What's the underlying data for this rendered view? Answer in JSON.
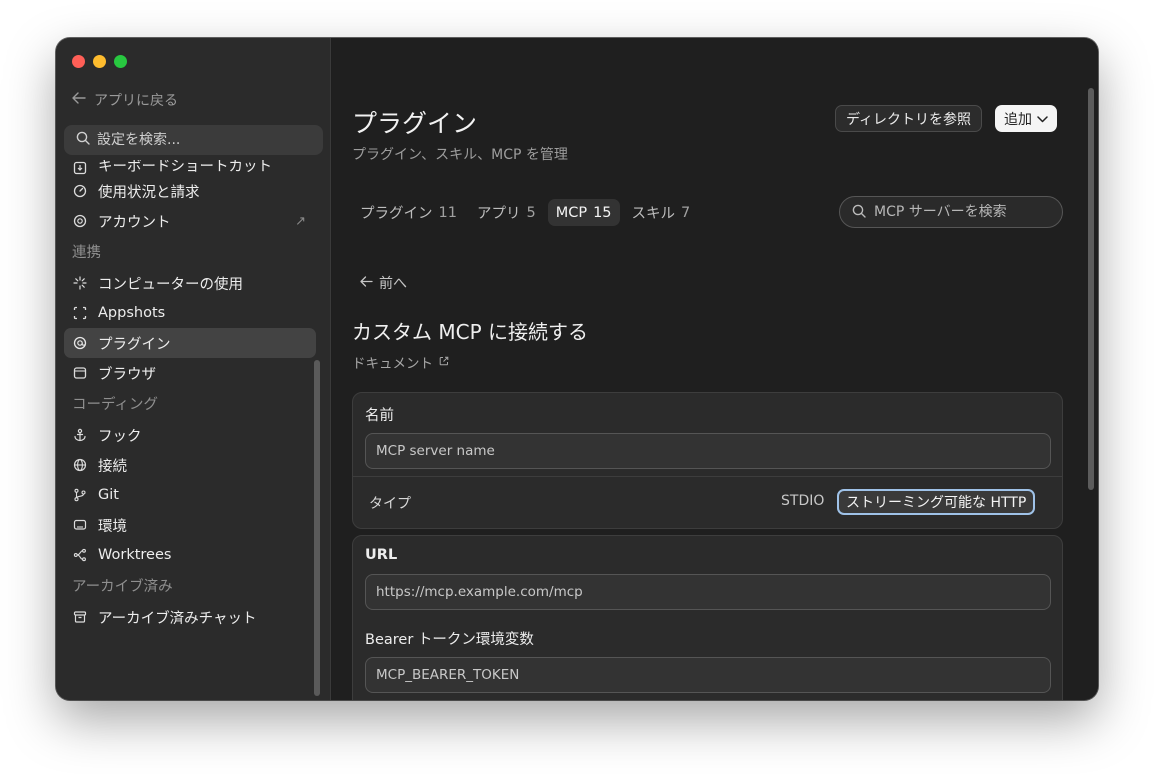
{
  "sidebar": {
    "back_label": "アプリに戻る",
    "search_placeholder": "設定を検索...",
    "items_top": [
      {
        "label": "キーボードショートカット"
      },
      {
        "label": "使用状況と請求"
      },
      {
        "label": "アカウント"
      }
    ],
    "section_integrations": "連携",
    "items_integrations": [
      {
        "label": "コンピューターの使用"
      },
      {
        "label": "Appshots"
      },
      {
        "label": "プラグイン"
      },
      {
        "label": "ブラウザ"
      }
    ],
    "section_coding": "コーディング",
    "items_coding": [
      {
        "label": "フック"
      },
      {
        "label": "接続"
      },
      {
        "label": "Git"
      },
      {
        "label": "環境"
      },
      {
        "label": "Worktrees"
      }
    ],
    "section_archived": "アーカイブ済み",
    "items_archived": [
      {
        "label": "アーカイブ済みチャット"
      }
    ]
  },
  "header": {
    "title": "プラグイン",
    "subtitle": "プラグイン、スキル、MCP を管理",
    "browse_button": "ディレクトリを参照",
    "add_button": "追加"
  },
  "tabs": [
    {
      "label": "プラグイン",
      "count": "11"
    },
    {
      "label": "アプリ",
      "count": "5"
    },
    {
      "label": "MCP",
      "count": "15"
    },
    {
      "label": "スキル",
      "count": "7"
    }
  ],
  "mcp_search_placeholder": "MCP サーバーを検索",
  "back_prev": "前へ",
  "form": {
    "title": "カスタム MCP に接続する",
    "doc_link": "ドキュメント",
    "name_label": "名前",
    "name_placeholder": "MCP server name",
    "type_label": "タイプ",
    "type_option_stdio": "STDIO",
    "type_option_http": "ストリーミング可能な HTTP",
    "url_label": "URL",
    "url_placeholder": "https://mcp.example.com/mcp",
    "bearer_label": "Bearer トークン環境変数",
    "bearer_placeholder": "MCP_BEARER_TOKEN"
  }
}
